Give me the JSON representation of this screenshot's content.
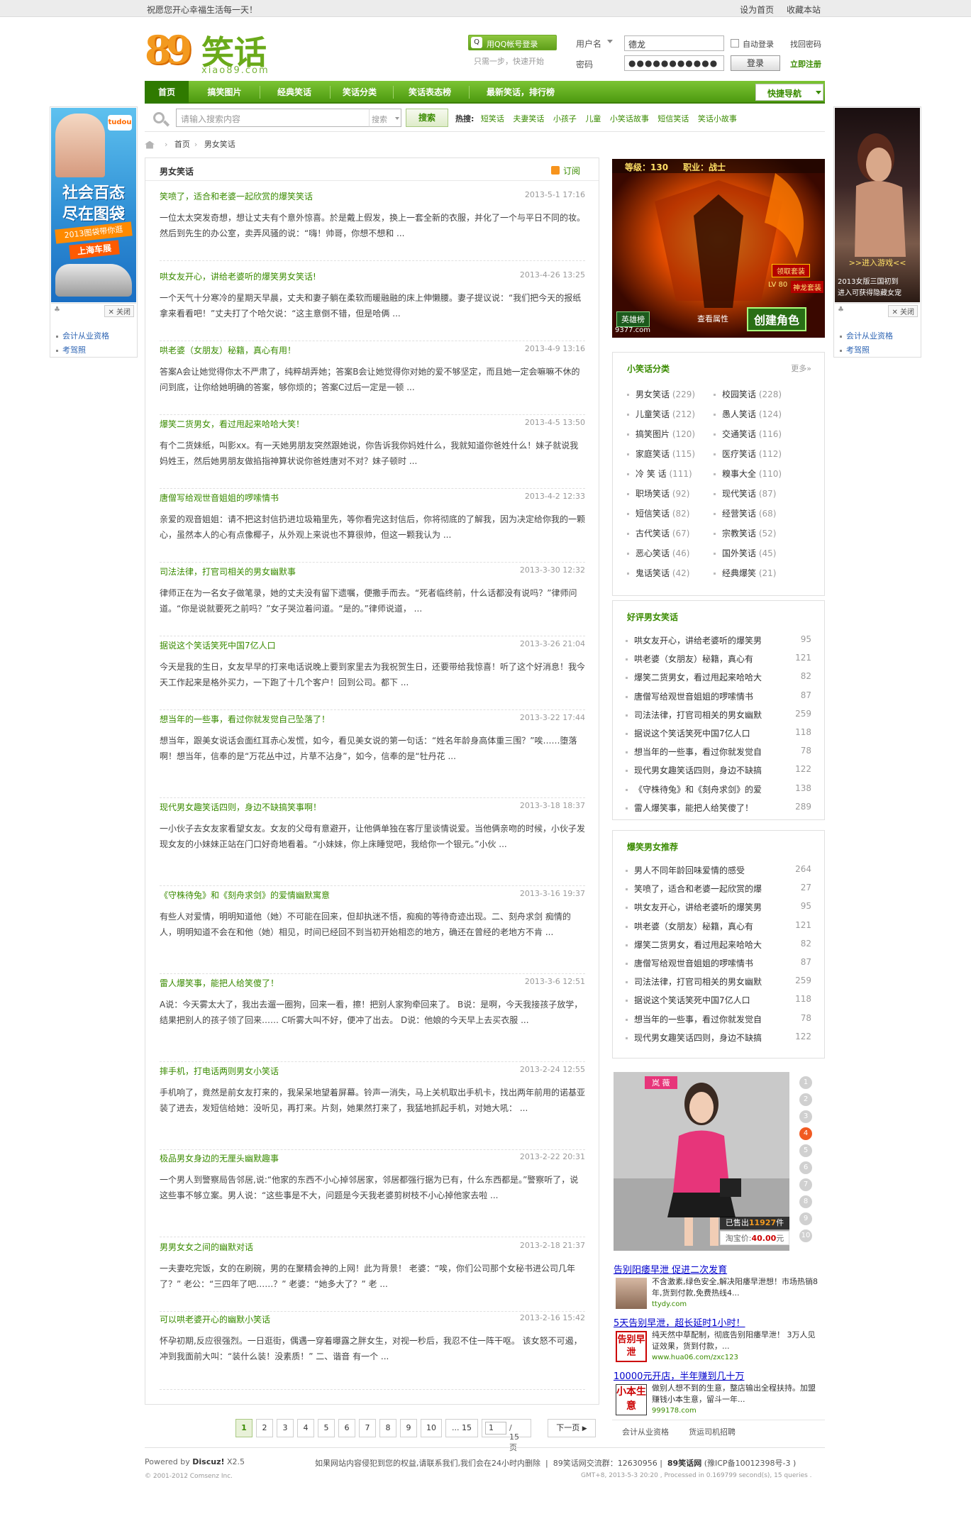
{
  "topbar": {
    "welcome": "祝愿您开心幸福生活每一天！",
    "links": [
      "设为首页",
      "收藏本站"
    ]
  },
  "logo": {
    "numbers": "89",
    "text": "笑话",
    "sub": "xiao89.com"
  },
  "login": {
    "qq_button": "用QQ帐号登录",
    "qq_icon": "qq-icon",
    "qq_hint": "只需一步，快速开始",
    "user_label": "用户名",
    "user_value": "德龙",
    "pass_label": "密码",
    "pass_value": "●●●●●●●●●●●",
    "auto_login": "自动登录",
    "find_password": "找回密码",
    "login_button": "登录",
    "register": "立即注册"
  },
  "nav": {
    "items": [
      "首页",
      "搞笑图片",
      "经典笑话",
      "笑话分类",
      "笑话表态榜",
      "最新笑话，排行榜"
    ],
    "quick_nav": "快捷导航"
  },
  "search": {
    "placeholder": "请输入搜索内容",
    "type": "搜索",
    "button": "搜索",
    "hot_label": "热搜:",
    "hot_words": [
      "短笑话",
      "夫妻笑话",
      "小孩子",
      "儿童",
      "小笑话故事",
      "短信笑话",
      "笑话小故事"
    ]
  },
  "breadcrumb": {
    "items": [
      "首页",
      "男女笑话"
    ]
  },
  "main": {
    "title": "男女笑话",
    "rss": "订阅",
    "posts": [
      {
        "title": "笑喷了，适合和老婆一起欣赏的爆笑笑话",
        "date": "2013-5-1 17:16",
        "body": "一位太太突发奇想，想让丈夫有个意外惊喜。於是戴上假发，换上一套全新的衣服，并化了一个与平日不同的妆。然后到先生的办公室，卖弄风骚的说：“嗨！帅哥，你想不想和 ..."
      },
      {
        "title": "哄女友开心，讲给老婆听的爆笑男女笑话!",
        "date": "2013-4-26 13:25",
        "body": "一个天气十分寒冷的星期天早晨，丈夫和妻子躺在柔软而暖融融的床上伸懒腰。妻子提议说：“我们把今天的报纸拿来看看吧！”丈夫打了个哈欠说：“这主意倒不错，但是哈俩 ..."
      },
      {
        "title": "哄老婆（女朋友）秘籍，真心有用！",
        "date": "2013-4-9 13:16",
        "body": "答案A会让她觉得你太不严肃了，纯粹胡弄她；答案B会让她觉得你对她的爱不够坚定，而且她一定会嘛嘛不休的问到底，让你给她明确的答案，够你烦的；答案C过后一定是一顿 ..."
      },
      {
        "title": "爆笑二货男女，看过甩起来哈哈大笑！",
        "date": "2013-4-5 13:50",
        "body": "有个二货妹纸，叫影xx。有一天她男朋友突然跟她说，你告诉我你妈姓什么，我就知道你爸姓什么！妹子就说我妈姓王，然后她男朋友做掐指神算状说你爸姓唐对不对？妹子顿时 ..."
      },
      {
        "title": "唐僧写给观世音姐姐的啰嗦情书",
        "date": "2013-4-2 12:33",
        "body": "亲爱的观音姐姐：请不把这封信扔进垃圾箱里先，等你看完这封信后，你将彻底的了解我，因为决定给你我的一颗心，虽然本人的心有点像椰子，从外观上来说也不算很帅，但这一颗我认为 ..."
      },
      {
        "title": "司法法律，打官司相关的男女幽默事",
        "date": "2013-3-30 12:32",
        "body": "律师正在为一名女子做笔录，她的丈夫没有留下遗嘱，便撒手而去。“死者临终前，什么话都没有说吗？”律师问道。“你是说就要死之前吗？”女子哭泣着问道。“是的。”律师说道， ..."
      },
      {
        "title": "据说这个笑话笑死中国7亿人口",
        "date": "2013-3-26 21:04",
        "body": "今天是我的生日，女友早早的打来电话说晚上要到家里去为我祝贺生日，还要带给我惊喜！听了这个好消息！我今天工作起来是格外买力，一下跑了十几个客户！回到公司。都下 ..."
      },
      {
        "title": "想当年的一些事，看过你就发觉自己坠落了！",
        "date": "2013-3-22 17:44",
        "body": "想当年，跟美女说话会面红耳赤心发慌，如今，看见美女说的第一句话：“姓名年龄身高体重三围？”唉……堕落啊！想当年，信奉的是“万花丛中过，片草不沾身”，如今，信奉的是“牡丹花 ..."
      },
      {
        "title": "现代男女趣笑话四则，身边不缺搞笑事啊！",
        "date": "2013-3-18 18:37",
        "body": "一小伙子去女友家看望女友。女友的父母有意避开，让他俩单独在客厅里谈情说爱。当他俩亲吻的时候，小伙子发现女友的小妹妹正站在门口好奇地看着。“小妹妹，你上床睡觉吧，我给你一个银元。”小伙 ..."
      },
      {
        "title": "《守株待兔》和《刻舟求剑》的爱情幽默寓意",
        "date": "2013-3-16 19:37",
        "body": "有些人对爱情，明明知道他（她）不可能在回来，但却执迷不悟，痴痴的等待奇迹出现。二、刻舟求剑 痴情的人，明明知道不会在和他（她）相见，时间已经回不到当初开始相恋的地方，确还在曾经的老地方不肯 ..."
      },
      {
        "title": "雷人爆笑事，能把人给笑傻了！",
        "date": "2013-3-6 12:51",
        "body": "A说：今天雾太大了，我出去遛一圈狗，回来一看，擦！把别人家狗牵回来了。 B说：是啊，今天我接孩子放学，结果把别人的孩子领了回来…… C听雾大叫不好，便冲了出去。 D说：他娘的今天早上去买衣服 ..."
      },
      {
        "title": "摔手机，打电话两则男女小笑话",
        "date": "2013-2-24 12:55",
        "body": "手机响了，竟然是前女友打来的，我呆呆地望着屏幕。铃声一消失，马上关机取出手机卡，找出两年前用的诺基亚装了进去，发短信给她：没听见，再打来。片刻，她果然打来了，我猛地抓起手机，对她大吼： ..."
      },
      {
        "title": "极品男女身边的无厘头幽默趣事",
        "date": "2013-2-22 20:31",
        "body": "一个男人到警察局告邻居,说:“他家的东西不小心掉邻居家，邻居都强行据为已有，什么东西都是。”警察听了，说这些事不够立案。男人说：“这些事是不大，问题是今天我老婆剪树枝不小心掉他家去啦 ..."
      },
      {
        "title": "男男女女之间的幽默对话",
        "date": "2013-2-18 21:37",
        "body": "一夫妻吃完饭，女的在刷碗，男的在聚精会神的上网！此为背景！ 老婆：“唉，你们公司那个女秘书进公司几年了？” 老公：“三四年了吧……？” 老婆：“她多大了？” 老 ..."
      },
      {
        "title": "可以哄老婆开心的幽默小笑话",
        "date": "2013-2-16 15:42",
        "body": "怀孕初期,反应很强烈。一日逛街，偶遇一穿着曝露之胖女生，对视一秒后，我忍不住一阵干呕。 该女怒不可遏，冲到我面前大叫：“装什么装！没素质！” 二、谐音 有一个 ..."
      }
    ]
  },
  "pager": {
    "pages": [
      "1",
      "2",
      "3",
      "4",
      "5",
      "6",
      "7",
      "8",
      "9",
      "10",
      "... 15"
    ],
    "current_input": "1",
    "total": "/ 15 页",
    "next": "下一页"
  },
  "sidebar": {
    "game_ad": {
      "level_label": "等级：130",
      "job_label": "职业：战士",
      "buttons": [
        "英雄榜",
        "查看属性",
        "创建角色"
      ],
      "side_tags": [
        "领取套装",
        "LV 80",
        "神龙套装"
      ],
      "domain": "9377.com"
    },
    "categories": {
      "title": "小笑话分类",
      "more": "更多»",
      "items": [
        {
          "name": "男女笑话",
          "count": "(229)"
        },
        {
          "name": "校园笑话",
          "count": "(228)"
        },
        {
          "name": "儿童笑话",
          "count": "(212)"
        },
        {
          "name": "愚人笑话",
          "count": "(124)"
        },
        {
          "name": "搞笑图片",
          "count": "(120)"
        },
        {
          "name": "交通笑话",
          "count": "(116)"
        },
        {
          "name": "家庭笑话",
          "count": "(115)"
        },
        {
          "name": "医疗笑话",
          "count": "(112)"
        },
        {
          "name": "冷 笑 话",
          "count": "(111)"
        },
        {
          "name": "糗事大全",
          "count": "(110)"
        },
        {
          "name": "职场笑话",
          "count": "(92)"
        },
        {
          "name": "现代笑话",
          "count": "(87)"
        },
        {
          "name": "短信笑话",
          "count": "(82)"
        },
        {
          "name": "经营笑话",
          "count": "(68)"
        },
        {
          "name": "古代笑话",
          "count": "(67)"
        },
        {
          "name": "宗教笑话",
          "count": "(52)"
        },
        {
          "name": "恶心笑话",
          "count": "(46)"
        },
        {
          "name": "国外笑话",
          "count": "(45)"
        },
        {
          "name": "鬼话笑话",
          "count": "(42)"
        },
        {
          "name": "经典爆笑",
          "count": "(21)"
        }
      ]
    },
    "top_rated": {
      "title": "好评男女笑话",
      "items": [
        {
          "title": "哄女友开心，讲给老婆听的爆笑男",
          "num": "95"
        },
        {
          "title": "哄老婆（女朋友）秘籍，真心有",
          "num": "121"
        },
        {
          "title": "爆笑二货男女，看过甩起来哈哈大",
          "num": "82"
        },
        {
          "title": "唐僧写给观世音姐姐的啰嗦情书",
          "num": "87"
        },
        {
          "title": "司法法律，打官司相关的男女幽默",
          "num": "259"
        },
        {
          "title": "据说这个笑话笑死中国7亿人口",
          "num": "118"
        },
        {
          "title": "想当年的一些事，看过你就发觉自",
          "num": "78"
        },
        {
          "title": "现代男女趣笑话四则，身边不缺搞",
          "num": "122"
        },
        {
          "title": "《守株待兔》和《刻舟求剑》的爱",
          "num": "138"
        },
        {
          "title": "雷人爆笑事，能把人给笑傻了！",
          "num": "289"
        }
      ]
    },
    "recommended": {
      "title": "爆笑男女推荐",
      "items": [
        {
          "title": "男人不同年龄回味爱情的感受",
          "num": "264"
        },
        {
          "title": "笑喷了，适合和老婆一起欣赏的爆",
          "num": "27"
        },
        {
          "title": "哄女友开心，讲给老婆听的爆笑男",
          "num": "95"
        },
        {
          "title": "哄老婆（女朋友）秘籍，真心有",
          "num": "121"
        },
        {
          "title": "爆笑二货男女，看过甩起来哈哈大",
          "num": "82"
        },
        {
          "title": "唐僧写给观世音姐姐的啰嗦情书",
          "num": "87"
        },
        {
          "title": "司法法律，打官司相关的男女幽默",
          "num": "259"
        },
        {
          "title": "据说这个笑话笑死中国7亿人口",
          "num": "118"
        },
        {
          "title": "想当年的一些事，看过你就发觉自",
          "num": "78"
        },
        {
          "title": "现代男女趣笑话四则，身边不缺搞",
          "num": "122"
        }
      ]
    },
    "fashion_ad": {
      "name": "岚 薇",
      "sold_label": "已售出",
      "sold": "11927",
      "sold_unit": "件",
      "price_label": "淘宝价:",
      "price": "40.00",
      "price_unit": "元",
      "dots": [
        "1",
        "2",
        "3",
        "4",
        "5",
        "6",
        "7",
        "8",
        "9",
        "10"
      ],
      "active_dot": 3
    },
    "text_ads": [
      {
        "title": "告别阳痿早泄 促进二次发育",
        "desc": "不含激素,绿色安全,解决阳痿早泄想！市场热销8年,货到付款,免费热线4...",
        "url": "ttydy.com"
      },
      {
        "title": "5天告别早泄，超长延时1小时！",
        "desc": "纯天然中草配制，彻底告别阳痿早泄！ 3万人见证效果，货到付款，...",
        "url": "www.hua06.com/zxc123",
        "badge": "告别早泄"
      },
      {
        "title": "10000元开店，半年赚到几十万",
        "desc": "做别人想不到的生意，整店输出全程扶持。加盟赚钱小本生意，留斗一年...",
        "url": "999178.com",
        "badge": "小本生意"
      }
    ],
    "text_ad_footer": [
      "会计从业资格",
      "货运司机招聘"
    ]
  },
  "left_ad": {
    "headline1": "社会百态",
    "headline2": "尽在图袋",
    "tag": "2013图袋带你逛",
    "tag2": "上海车展",
    "brand": "tudou",
    "close": "关闭",
    "links": [
      "会计从业资格",
      "考驾照"
    ]
  },
  "right_ad": {
    "caption1": ">>进入游戏<<",
    "caption2": "2013女版三国初到",
    "caption3": "进入可获得隐藏女宠",
    "close": "关闭",
    "links": [
      "会计从业资格",
      "考驾照"
    ]
  },
  "footer": {
    "powered": "Powered by",
    "brand": "Discuz!",
    "version": "X2.5",
    "copyright": "© 2001-2012 Comsenz Inc.",
    "notice": "如果网站内容侵犯到您的权益,请联系我们,我们会在24小时内删除",
    "qq_group": "89笑话网交流群：12630956",
    "site": "89笑话网",
    "icp": "(豫ICP备10012398号-3 )",
    "gmt": "GMT+8, 2013-5-3 20:20 , Processed in 0.169799 second(s), 15 queries ."
  },
  "colors": {
    "brand_green": "#3a8b00",
    "nav_green": "#5fa91f",
    "accent_orange": "#f39a1f",
    "link_blue": "#2d64b3"
  }
}
